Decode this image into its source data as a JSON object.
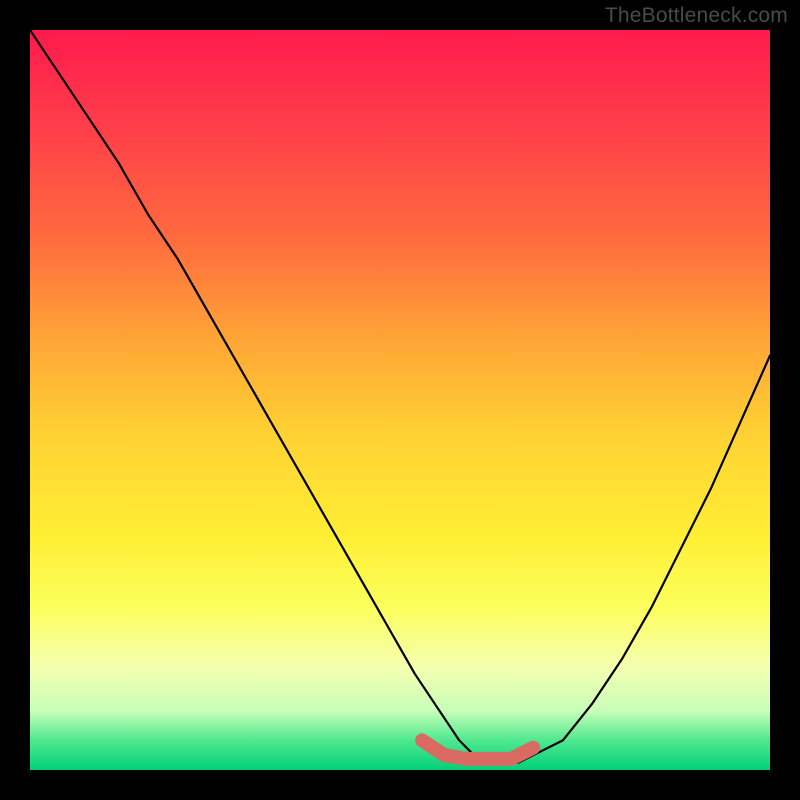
{
  "watermark": "TheBottleneck.com",
  "colors": {
    "background": "#000000",
    "curve_stroke": "#000000",
    "highlight_stroke": "#d86a61",
    "gradient_top": "#ff1a4d",
    "gradient_bottom": "#00d17a"
  },
  "chart_data": {
    "type": "line",
    "title": "",
    "xlabel": "",
    "ylabel": "",
    "xlim": [
      0,
      100
    ],
    "ylim": [
      0,
      100
    ],
    "grid": false,
    "note": "V-shaped bottleneck curve on a red→green vertical gradient. X and Y axes carry no tick labels; only shape is conveyed. Values are approximate percentage positions within the plot area (0 = left/bottom, 100 = right/top). The highlighted flat region near the trough is rendered in a salmon color over the black curve.",
    "series": [
      {
        "name": "bottleneck-curve",
        "x": [
          0,
          4,
          8,
          12,
          16,
          20,
          24,
          28,
          32,
          36,
          40,
          44,
          48,
          52,
          56,
          58,
          60,
          62,
          64,
          66,
          68,
          72,
          76,
          80,
          84,
          88,
          92,
          96,
          100
        ],
        "y": [
          100,
          94,
          88,
          82,
          75,
          69,
          62,
          55,
          48,
          41,
          34,
          27,
          20,
          13,
          7,
          4,
          2,
          1,
          1,
          1,
          2,
          4,
          9,
          15,
          22,
          30,
          38,
          47,
          56
        ]
      }
    ],
    "highlight": {
      "name": "optimal-region",
      "x": [
        53,
        56,
        59,
        62,
        65,
        68
      ],
      "y": [
        4,
        2,
        1.5,
        1.5,
        1.5,
        3
      ]
    }
  }
}
